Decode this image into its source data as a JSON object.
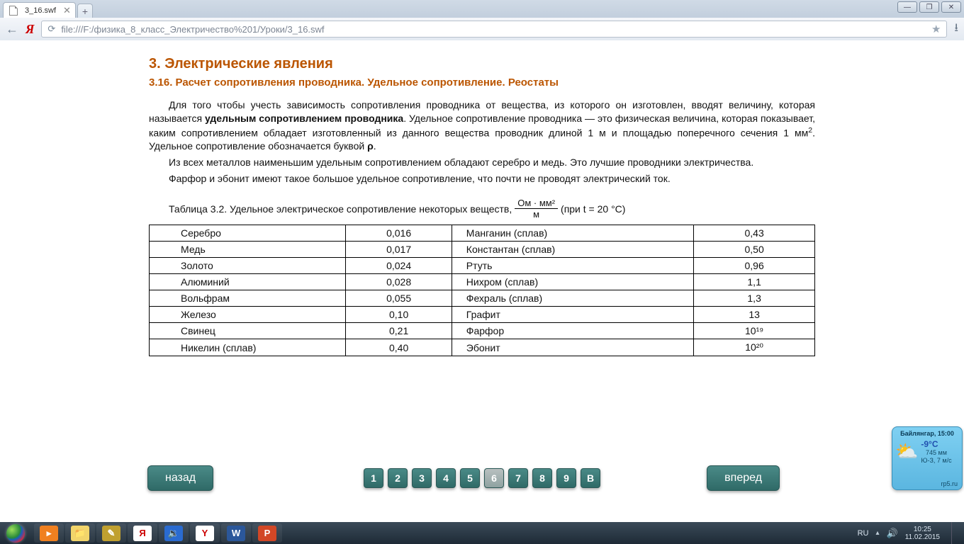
{
  "window": {
    "min": "—",
    "restore": "❐",
    "close": "✕"
  },
  "tab": {
    "title": "3_16.swf",
    "close": "✕",
    "new": "+"
  },
  "addr": {
    "back_glyph": "←",
    "ya": "Я",
    "reload": "⟳",
    "url": "file:///F:/физика_8_класс_Электричество%201/Уроки/3_16.swf",
    "star": "★",
    "download": "⭳"
  },
  "doc": {
    "chapter": "3. Электрические явления",
    "section": "3.16. Расчет сопротивления проводника. Удельное сопротивление. Реостаты",
    "p1_a": "Для того чтобы учесть зависимость сопротивления проводника от вещества, из которого он изготовлен, вводят величину, которая называется ",
    "p1_b": "удельным сопротивлением проводника",
    "p1_c": ". Удельное сопротивление проводника — это физическая величина, которая показывает, каким сопротивлением обладает изготовленный из данного вещества проводник длиной 1 м и площадью поперечного сечения 1 мм",
    "p1_d": ". Удельное сопротивление обозначается буквой ",
    "p1_rho": "ρ",
    "p1_e": ".",
    "p2": "Из всех металлов наименьшим удельным сопротивлением обладают серебро и медь. Это лучшие проводники электричества.",
    "p3": "Фарфор и эбонит имеют такое большое удельное сопротивление, что почти не проводят электрический ток.",
    "caption_a": "Таблица 3.2. Удельное электрическое сопротивление некоторых веществ, ",
    "frac_num": "Ом · мм²",
    "frac_den": "м",
    "caption_b": " (при t = 20 °C)"
  },
  "table": {
    "rows": [
      {
        "m1": "Серебро",
        "v1": "0,016",
        "m2": "Манганин (сплав)",
        "v2": "0,43"
      },
      {
        "m1": "Медь",
        "v1": "0,017",
        "m2": "Константан (сплав)",
        "v2": "0,50"
      },
      {
        "m1": "Золото",
        "v1": "0,024",
        "m2": "Ртуть",
        "v2": "0,96"
      },
      {
        "m1": "Алюминий",
        "v1": "0,028",
        "m2": "Нихром (сплав)",
        "v2": "1,1"
      },
      {
        "m1": "Вольфрам",
        "v1": "0,055",
        "m2": "Фехраль (сплав)",
        "v2": "1,3"
      },
      {
        "m1": "Железо",
        "v1": "0,10",
        "m2": "Графит",
        "v2": "13"
      },
      {
        "m1": "Свинец",
        "v1": "0,21",
        "m2": "Фарфор",
        "v2": "10¹⁹"
      },
      {
        "m1": "Никелин (сплав)",
        "v1": "0,40",
        "m2": "Эбонит",
        "v2": "10²⁰"
      }
    ]
  },
  "pager": {
    "back": "назад",
    "forward": "вперед",
    "pages": [
      "1",
      "2",
      "3",
      "4",
      "5",
      "6",
      "7",
      "8",
      "9",
      "В"
    ],
    "active_index": 5
  },
  "weather": {
    "location": "Байлянгар, 15:00",
    "icon": "⛅",
    "temp": "-9°C",
    "pressure": "745 мм",
    "wind": "Ю-З, 7 м/с",
    "site": "rp5.ru"
  },
  "tray": {
    "lang": "RU",
    "chevron": "▴",
    "speaker": "🔊",
    "time": "10:25",
    "date": "11.02.2015"
  },
  "task_icons": [
    {
      "name": "media-player-icon",
      "bg": "#f08020",
      "label": "▸"
    },
    {
      "name": "explorer-icon",
      "bg": "#f2d56b",
      "label": "📁"
    },
    {
      "name": "note-icon",
      "bg": "#c0a030",
      "label": "✎"
    },
    {
      "name": "yandex-icon",
      "bg": "#ffffff",
      "label": "Я",
      "color": "#c00"
    },
    {
      "name": "sound-icon",
      "bg": "#2a6bd0",
      "label": "🔉"
    },
    {
      "name": "ybrowser-icon",
      "bg": "#ffffff",
      "label": "Y",
      "color": "#c00"
    },
    {
      "name": "word-icon",
      "bg": "#2b579a",
      "label": "W"
    },
    {
      "name": "powerpoint-icon",
      "bg": "#d24726",
      "label": "P"
    }
  ]
}
